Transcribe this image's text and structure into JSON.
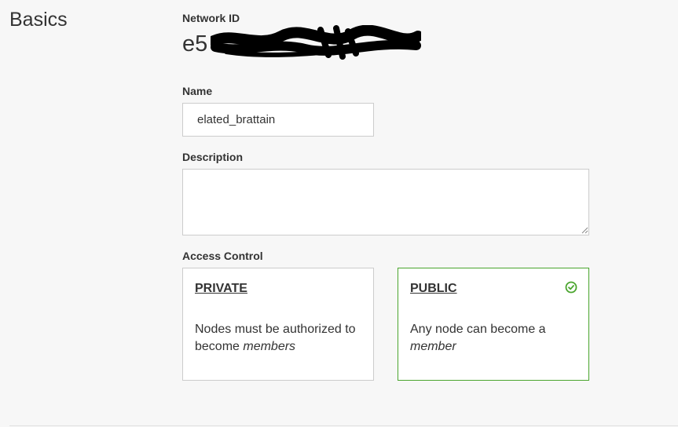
{
  "section": {
    "title": "Basics"
  },
  "network_id": {
    "label": "Network ID",
    "value_visible": "e5"
  },
  "name": {
    "label": "Name",
    "value": "elated_brattain"
  },
  "description": {
    "label": "Description",
    "value": ""
  },
  "access_control": {
    "label": "Access Control",
    "selected": "public",
    "options": [
      {
        "id": "private",
        "title": "PRIVATE",
        "desc_prefix": "Nodes must be authorized to become ",
        "desc_emphasis": "members"
      },
      {
        "id": "public",
        "title": "PUBLIC",
        "desc_prefix": "Any node can become a ",
        "desc_emphasis": "member"
      }
    ]
  },
  "colors": {
    "selected_border": "#4aa52e",
    "check_icon": "#4aa52e",
    "page_background": "#f7f7f7"
  },
  "icons": {
    "selected_indicator": "check-circle-icon"
  }
}
